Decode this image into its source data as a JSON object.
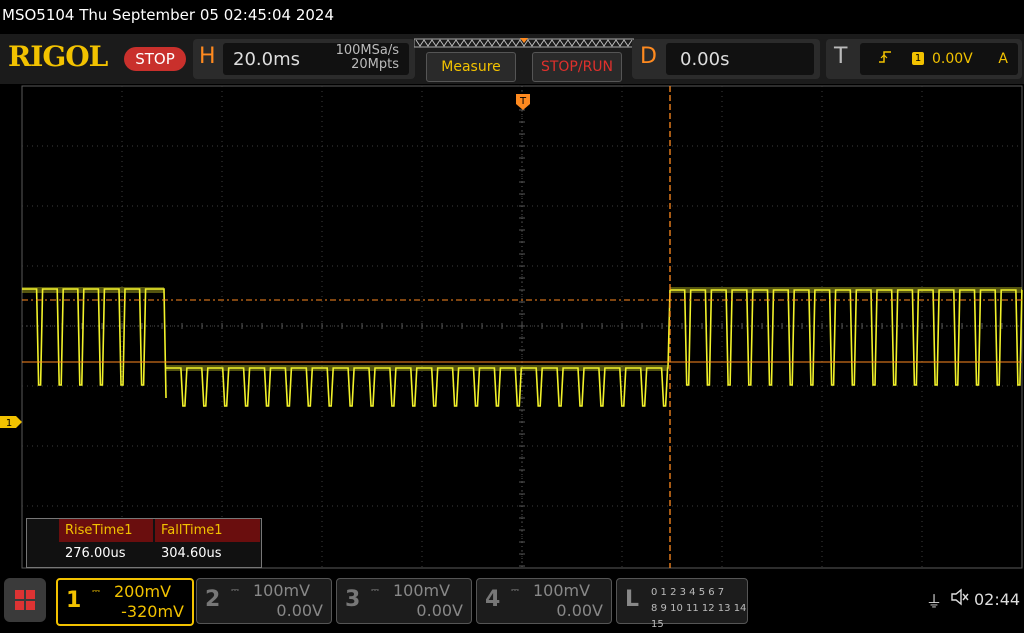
{
  "title": "MSO5104  Thu September 05 02:45:04 2024",
  "logo": "RIGOL",
  "run_state": "STOP",
  "horizontal": {
    "letter": "H",
    "timebase": "20.0ms",
    "sample_rate": "100MSa/s",
    "memory_depth": "20Mpts"
  },
  "buttons": {
    "measure": "Measure",
    "stop_run": "STOP/RUN"
  },
  "delay": {
    "letter": "D",
    "value": "0.00s"
  },
  "trigger": {
    "letter": "T",
    "channel": "1",
    "level": "0.00V",
    "coupling": "A",
    "edge_icon": "rising-edge-icon"
  },
  "measurements": [
    {
      "name": "RiseTime1",
      "value": "276.00us"
    },
    {
      "name": "FallTime1",
      "value": "304.60us"
    }
  ],
  "channel_marker": "1",
  "trigger_marker": "T",
  "channels": [
    {
      "num": "1",
      "scale": "200mV",
      "offset": "-320mV",
      "active": true
    },
    {
      "num": "2",
      "scale": "100mV",
      "offset": "0.00V",
      "active": false
    },
    {
      "num": "3",
      "scale": "100mV",
      "offset": "0.00V",
      "active": false
    },
    {
      "num": "4",
      "scale": "100mV",
      "offset": "0.00V",
      "active": false
    }
  ],
  "logic": {
    "letter": "L",
    "row1": "0 1 2 3   4 5 6 7",
    "row2": "8 9 10 11  12 13 14 15"
  },
  "status": {
    "clock": "02:44"
  },
  "colors": {
    "trace": "#f2f22a",
    "accent": "#ff8a1f",
    "channel1": "#f2c200",
    "stop": "#c9302c"
  }
}
